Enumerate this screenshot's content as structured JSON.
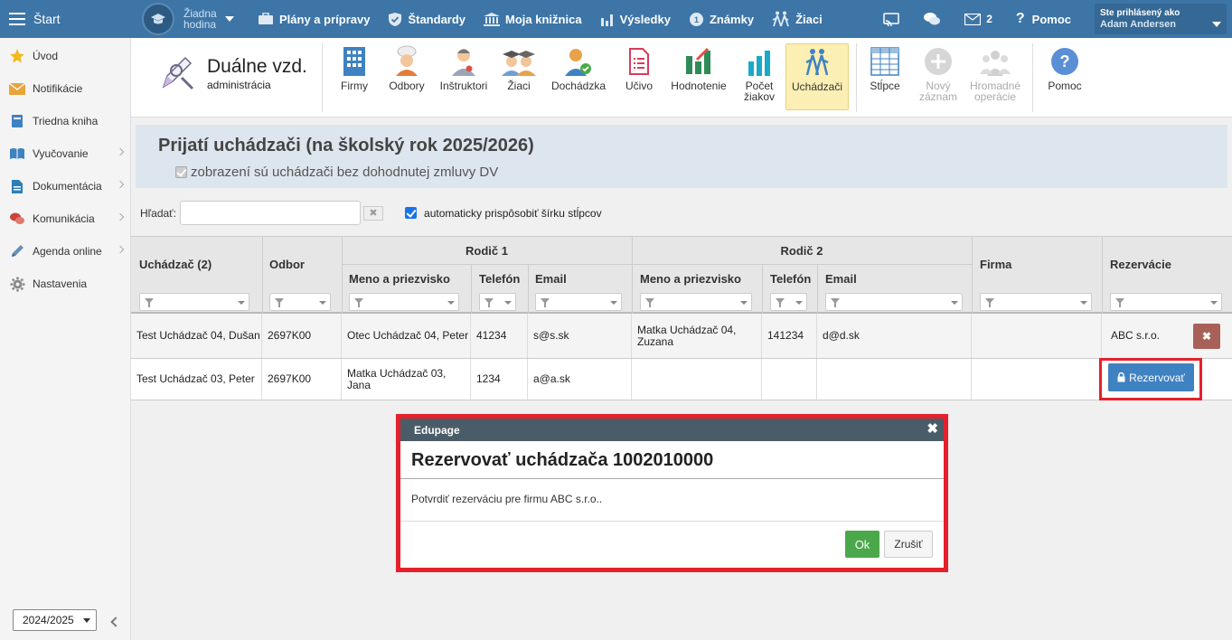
{
  "topbar": {
    "start_label": "Štart",
    "hour_label_1": "Žiadna",
    "hour_label_2": "hodina",
    "nav": [
      {
        "label": "Plány a prípravy",
        "icon": "briefcase-icon"
      },
      {
        "label": "Štandardy",
        "icon": "shield-check-icon"
      },
      {
        "label": "Moja knižnica",
        "icon": "library-icon"
      },
      {
        "label": "Výsledky",
        "icon": "bar-chart-icon"
      },
      {
        "label": "Známky",
        "icon": "grade-icon"
      },
      {
        "label": "Žiaci",
        "icon": "students-walking-icon"
      }
    ],
    "messages_count": "2",
    "help_label": "Pomoc",
    "user_caption": "Ste prihlásený ako",
    "user_name": "Adam Andersen",
    "colors": {
      "bar": "#3d75a7"
    }
  },
  "sidebar": {
    "items": [
      {
        "label": "Úvod",
        "icon": "star-icon"
      },
      {
        "label": "Notifikácie",
        "icon": "envelope-icon"
      },
      {
        "label": "Triedna kniha",
        "icon": "book-icon"
      },
      {
        "label": "Vyučovanie",
        "icon": "open-book-icon"
      },
      {
        "label": "Dokumentácia",
        "icon": "document-icon"
      },
      {
        "label": "Komunikácia",
        "icon": "chat-icon"
      },
      {
        "label": "Agenda online",
        "icon": "pen-icon"
      },
      {
        "label": "Nastavenia",
        "icon": "gear-icon"
      }
    ],
    "school_year": "2024/2025"
  },
  "toolbar": {
    "module_title": "Duálne vzd.",
    "module_sub": "administrácia",
    "buttons": [
      {
        "label": "Firmy"
      },
      {
        "label": "Odbory"
      },
      {
        "label": "Inštruktori"
      },
      {
        "label": "Žiaci"
      },
      {
        "label": "Dochádzka"
      },
      {
        "label": "Učivo"
      },
      {
        "label": "Hodnotenie"
      },
      {
        "label1": "Počet",
        "label2": "žiakov"
      },
      {
        "label": "Uchádzači"
      },
      {
        "label": "Stĺpce"
      },
      {
        "label1": "Nový",
        "label2": "záznam"
      },
      {
        "label1": "Hromadné",
        "label2": "operácie"
      },
      {
        "label": "Pomoc"
      }
    ]
  },
  "page": {
    "title": "Prijatí uchádzači (na školský rok 2025/2026)",
    "checkbox_label": "zobrazení sú uchádzači bez dohodnutej zmluvy DV",
    "search_label": "Hľadať:",
    "search_value": "",
    "autofit_label": "automaticky prispôsobiť šírku stĺpcov"
  },
  "grid": {
    "headers": {
      "applicant": "Uchádzač (2)",
      "field": "Odbor",
      "parent1": "Rodič 1",
      "parent2": "Rodič 2",
      "name": "Meno a priezvisko",
      "phone": "Telefón",
      "email": "Email",
      "company": "Firma",
      "reservations": "Rezervácie"
    },
    "rows": [
      {
        "applicant": "Test Uchádzač 04, Dušan",
        "field": "2697K00",
        "p1_name": "Otec Uchádzač 04, Peter",
        "p1_phone": "41234",
        "p1_email": "s@s.sk",
        "p2_name": "Matka Uchádzač 04, Zuzana",
        "p2_phone": "141234",
        "p2_email": "d@d.sk",
        "company": "",
        "reservation": "ABC s.r.o."
      },
      {
        "applicant": "Test Uchádzač 03, Peter",
        "field": "2697K00",
        "p1_name": "Matka Uchádzač 03, Jana",
        "p1_phone": "1234",
        "p1_email": "a@a.sk",
        "p2_name": "",
        "p2_phone": "",
        "p2_email": "",
        "company": "",
        "reservation_button": "Rezervovať"
      }
    ]
  },
  "modal": {
    "header": "Edupage",
    "title": "Rezervovať uchádzača 1002010000",
    "body": "Potvrdiť rezerváciu pre firmu ABC s.r.o..",
    "ok_label": "Ok",
    "cancel_label": "Zrušiť"
  }
}
